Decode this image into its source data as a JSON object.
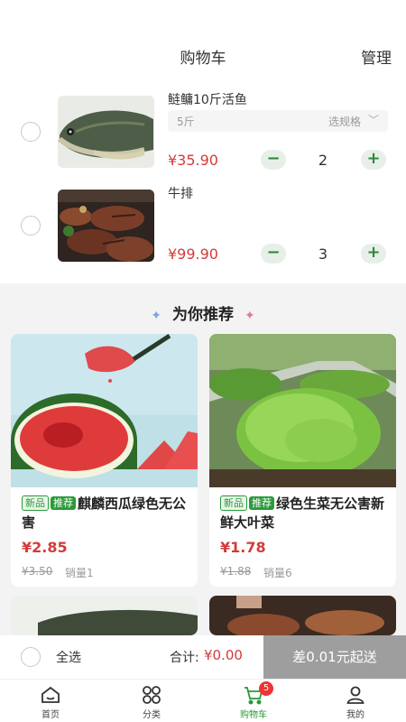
{
  "header": {
    "title": "购物车",
    "manage": "管理"
  },
  "cart": {
    "items": [
      {
        "name": "鲢鳙10斤活鱼",
        "spec": "5斤",
        "spec_select": "选规格",
        "price": "¥35.90",
        "qty": "2"
      },
      {
        "name": "牛排",
        "price": "¥99.90",
        "qty": "3"
      }
    ]
  },
  "recommend": {
    "title": "为你推荐",
    "cards": [
      {
        "tag_new": "新品",
        "tag_rec": "推荐",
        "name": "麒麟西瓜绿色无公害",
        "price": "¥2.85",
        "old_price": "¥3.50",
        "sales": "销量1"
      },
      {
        "tag_new": "新品",
        "tag_rec": "推荐",
        "name": "绿色生菜无公害新鲜大叶菜",
        "price": "¥1.78",
        "old_price": "¥1.88",
        "sales": "销量6"
      }
    ]
  },
  "bottom": {
    "select_all": "全选",
    "total_label": "合计:",
    "total_value": "¥0.00",
    "checkout": "差0.01元起送"
  },
  "tabs": [
    {
      "label": "首页",
      "icon": "home-icon"
    },
    {
      "label": "分类",
      "icon": "category-icon"
    },
    {
      "label": "购物车",
      "icon": "cart-icon",
      "badge": "5"
    },
    {
      "label": "我的",
      "icon": "user-icon"
    }
  ],
  "colors": {
    "accent": "#2a9a3a",
    "price": "#d43b3b",
    "checkout_disabled": "#9e9e9e"
  }
}
